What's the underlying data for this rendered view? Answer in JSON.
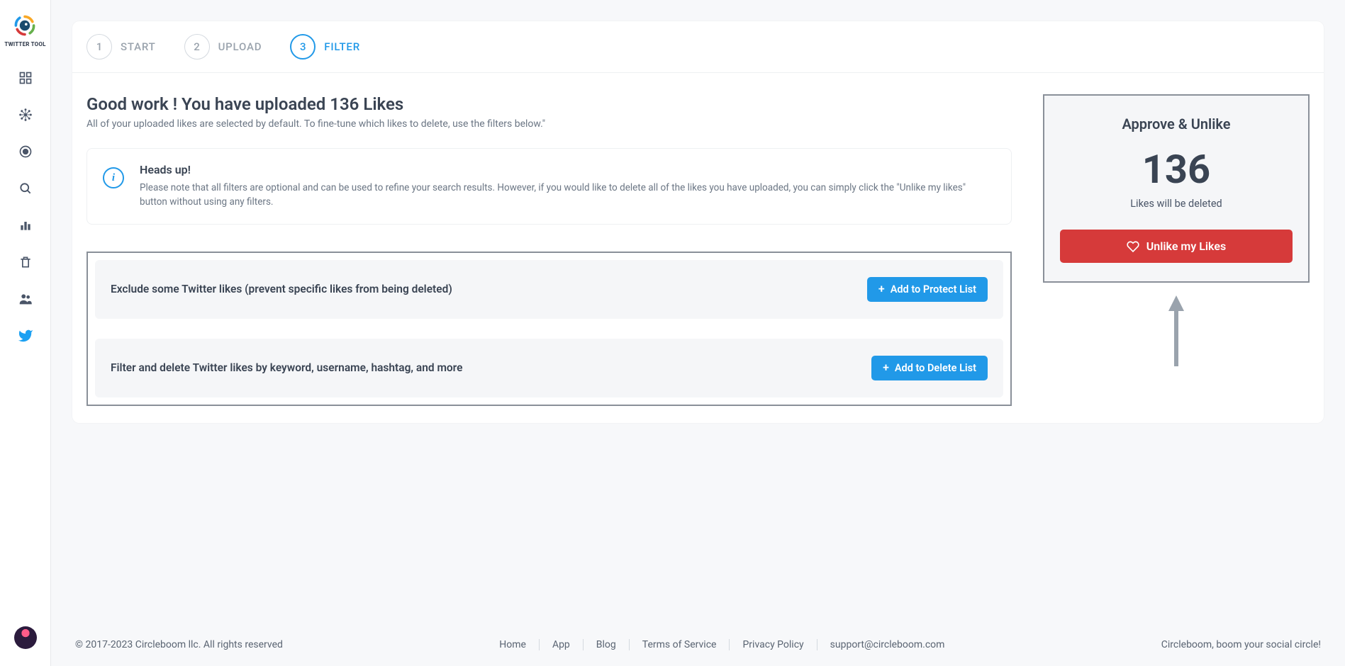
{
  "brand": {
    "name": "TWITTER TOOL"
  },
  "steps": [
    {
      "num": "1",
      "label": "START"
    },
    {
      "num": "2",
      "label": "UPLOAD"
    },
    {
      "num": "3",
      "label": "FILTER"
    }
  ],
  "active_step_index": 2,
  "page": {
    "title": "Good work ! You have uploaded 136 Likes",
    "subtitle": "All of your uploaded likes are selected by default. To fine-tune which likes to delete, use the filters below.\""
  },
  "headsup": {
    "title": "Heads up!",
    "body": "Please note that all filters are optional and can be used to refine your search results. However, if you would like to delete all of the likes you have uploaded, you can simply click the \"Unlike my likes\" button without using any filters."
  },
  "filters": {
    "protect": {
      "text": "Exclude some Twitter likes (prevent specific likes from being deleted)",
      "button": "Add to Protect List"
    },
    "delete": {
      "text": "Filter and delete Twitter likes by keyword, username, hashtag, and more",
      "button": "Add to Delete List"
    }
  },
  "approve": {
    "title": "Approve & Unlike",
    "count": "136",
    "caption": "Likes will be deleted",
    "button": "Unlike my Likes"
  },
  "footer": {
    "copyright": "© 2017-2023 Circleboom llc. All rights reserved",
    "links": {
      "home": "Home",
      "app": "App",
      "blog": "Blog",
      "tos": "Terms of Service",
      "privacy": "Privacy Policy",
      "support": "support@circleboom.com"
    },
    "tagline": "Circleboom, boom your social circle!"
  }
}
